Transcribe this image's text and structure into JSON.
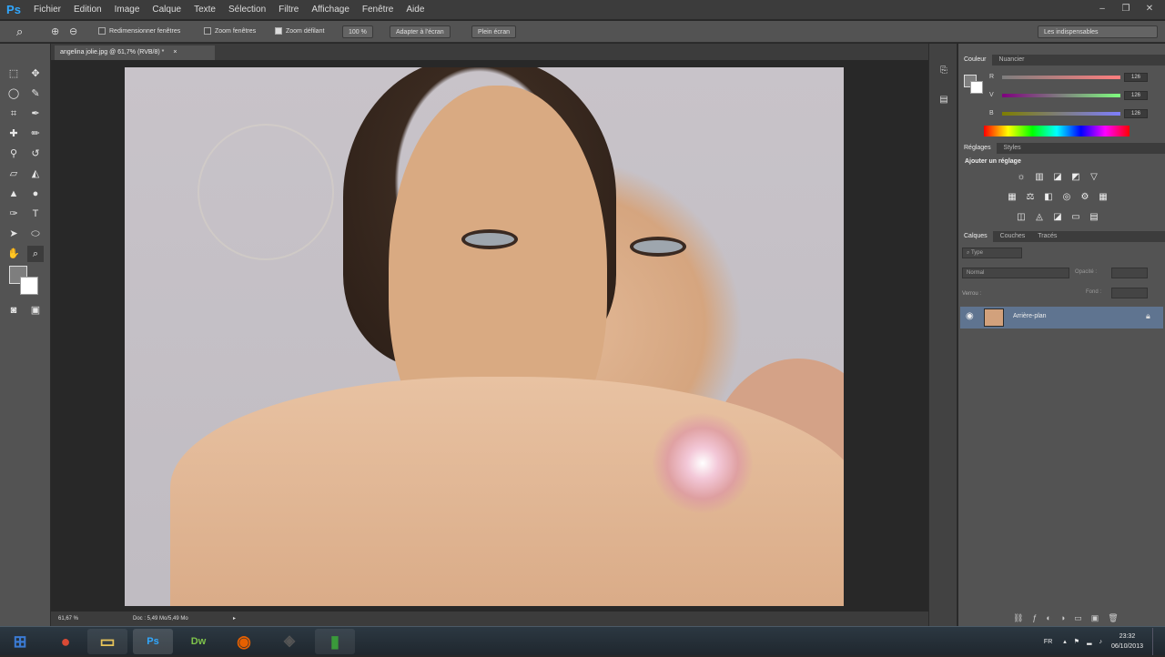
{
  "app": {
    "logo": "Ps"
  },
  "menu": [
    "Fichier",
    "Edition",
    "Image",
    "Calque",
    "Texte",
    "Sélection",
    "Filtre",
    "Affichage",
    "Fenêtre",
    "Aide"
  ],
  "window_controls": {
    "minimize": "–",
    "restore": "❐",
    "close": "✕"
  },
  "options_bar": {
    "resize_windows": "Redimensionner fenêtres",
    "zoom_all": "Zoom fenêtres",
    "scrubby_zoom": "Zoom défilant",
    "zoom_value": "100 %",
    "fit_screen": "Adapter à l'écran",
    "fill_screen": "Plein écran",
    "workspace": "Les indispensables"
  },
  "document": {
    "tab_title": "angelina jolie.jpg @ 61,7% (RVB/8) *",
    "zoom_status": "61,67 %",
    "doc_info": "Doc : 5,49 Mo/5,49 Mo"
  },
  "color_panel": {
    "tabs": [
      "Couleur",
      "Nuancier"
    ],
    "channels": [
      {
        "label": "R",
        "value": "126"
      },
      {
        "label": "V",
        "value": "126"
      },
      {
        "label": "B",
        "value": "126"
      }
    ]
  },
  "adjustments_panel": {
    "tabs": [
      "Réglages",
      "Styles"
    ],
    "title": "Ajouter un réglage"
  },
  "layers_panel": {
    "tabs": [
      "Calques",
      "Couches",
      "Tracés"
    ],
    "filter_type": "Type",
    "blend_mode": "Normal",
    "opacity_label": "Opacité :",
    "lock_label": "Verrou :",
    "fill_label": "Fond :",
    "layer_name": "Arrière-plan"
  },
  "taskbar": {
    "apps": [
      {
        "name": "windows-start",
        "glyph": "⊞",
        "color": "#3b7bd4"
      },
      {
        "name": "chrome",
        "glyph": "●",
        "color": "#d94a35"
      },
      {
        "name": "explorer",
        "glyph": "▭",
        "color": "#e8c45a"
      },
      {
        "name": "photoshop",
        "glyph": "Ps",
        "color": "#31a8ff"
      },
      {
        "name": "dreamweaver",
        "glyph": "Dw",
        "color": "#7ec34b"
      },
      {
        "name": "firefox",
        "glyph": "◉",
        "color": "#e66000"
      },
      {
        "name": "app-7",
        "glyph": "◈",
        "color": "#555555"
      },
      {
        "name": "app-8",
        "glyph": "▮",
        "color": "#3a9a3a"
      }
    ],
    "tray_language": "FR",
    "time": "23:32",
    "date": "06/10/2013"
  },
  "colors": {
    "accent": "#31a8ff",
    "layer_selected": "#5f7490"
  }
}
